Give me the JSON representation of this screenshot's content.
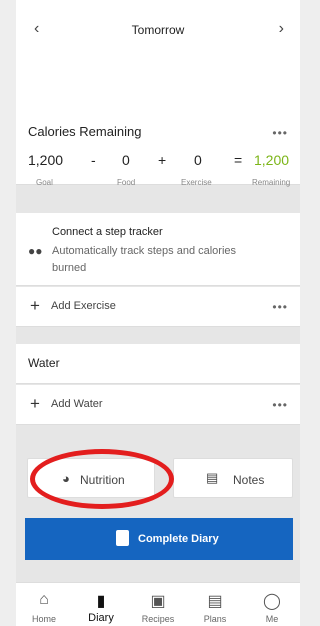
{
  "header": {
    "title": "Tomorrow",
    "prev_icon": "chevron-left-icon",
    "next_icon": "chevron-right-icon"
  },
  "calories": {
    "title": "Calories Remaining",
    "more": "•••",
    "goal_value": "1,200",
    "goal_label": "Goal",
    "minus": "-",
    "food_value": "0",
    "food_label": "Food",
    "plus": "+",
    "exercise_value": "0",
    "exercise_label": "Exercise",
    "equals": "=",
    "remaining_value": "1,200",
    "remaining_label": "Remaining",
    "remaining_color": "#7cb518"
  },
  "tracker": {
    "title": "Connect a step tracker",
    "description": "Automatically track steps and calories burned",
    "icon": "footsteps-icon"
  },
  "exercise": {
    "add_label": "Add Exercise",
    "more": "•••"
  },
  "water": {
    "title": "Water",
    "add_label": "Add Water",
    "more": "•••"
  },
  "actions": {
    "nutrition_label": "Nutrition",
    "notes_label": "Notes",
    "complete_label": "Complete Diary"
  },
  "accent_color": "#1565c0",
  "tabs": [
    {
      "label": "Home",
      "icon": "home-icon"
    },
    {
      "label": "Diary",
      "icon": "diary-icon",
      "active": true
    },
    {
      "label": "Recipes",
      "icon": "recipes-icon"
    },
    {
      "label": "Plans",
      "icon": "plans-icon"
    },
    {
      "label": "Me",
      "icon": "person-icon"
    }
  ]
}
